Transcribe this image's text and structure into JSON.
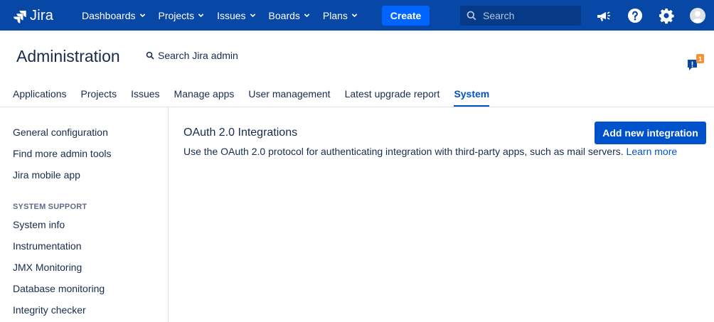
{
  "topbar": {
    "logo_text": "Jira",
    "nav": [
      {
        "label": "Dashboards"
      },
      {
        "label": "Projects"
      },
      {
        "label": "Issues"
      },
      {
        "label": "Boards"
      },
      {
        "label": "Plans"
      }
    ],
    "create_label": "Create",
    "search_placeholder": "Search",
    "icons": [
      "megaphone-icon",
      "help-icon",
      "settings-gear-icon",
      "user-avatar-icon"
    ],
    "bg_color": "#0747a6"
  },
  "header": {
    "title": "Administration",
    "search_label": "Search Jira admin",
    "feedback_badge": "1"
  },
  "tabs": [
    {
      "label": "Applications"
    },
    {
      "label": "Projects"
    },
    {
      "label": "Issues"
    },
    {
      "label": "Manage apps"
    },
    {
      "label": "User management"
    },
    {
      "label": "Latest upgrade report"
    },
    {
      "label": "System",
      "active": true
    }
  ],
  "sidebar": {
    "items_top": [
      {
        "label": "General configuration"
      },
      {
        "label": "Find more admin tools"
      },
      {
        "label": "Jira mobile app"
      }
    ],
    "section_heading": "SYSTEM SUPPORT",
    "items_support": [
      {
        "label": "System info"
      },
      {
        "label": "Instrumentation"
      },
      {
        "label": "JMX Monitoring"
      },
      {
        "label": "Database monitoring"
      },
      {
        "label": "Integrity checker"
      }
    ]
  },
  "main": {
    "title": "OAuth 2.0 Integrations",
    "add_button_label": "Add new integration",
    "description": "Use the OAuth 2.0 protocol for authenticating integration with third-party apps, such as mail servers.",
    "learn_more": "Learn more"
  }
}
